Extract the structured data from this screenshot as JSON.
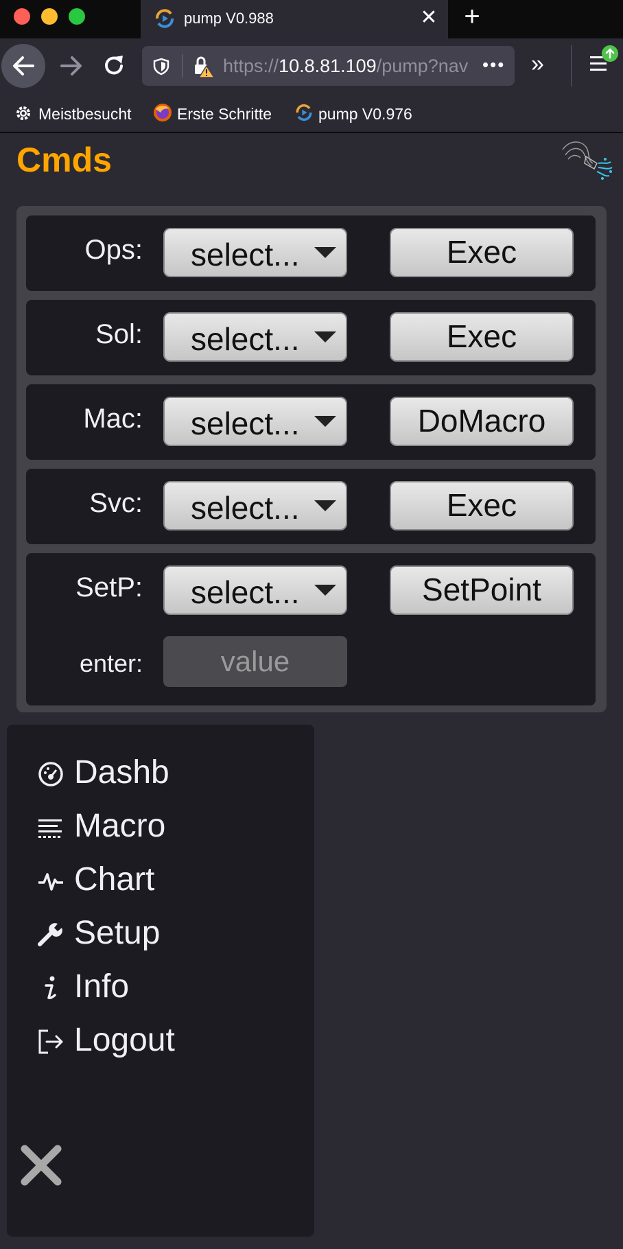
{
  "browser": {
    "tab_title": "pump V0.988",
    "tab_close": "✕",
    "new_tab": "+",
    "url": {
      "scheme": "https://",
      "host": "10.8.81.109",
      "path": "/pump?nav",
      "more": "•••"
    },
    "overflow": "»",
    "bookmarks": [
      "Meistbesucht",
      "Erste Schritte",
      "pump V0.976"
    ]
  },
  "page": {
    "title": "Cmds",
    "accent_color": "#ffa500",
    "rows": [
      {
        "label": "Ops:",
        "select": "select...",
        "button": "Exec"
      },
      {
        "label": "Sol:",
        "select": "select...",
        "button": "Exec"
      },
      {
        "label": "Mac:",
        "select": "select...",
        "button": "DoMacro"
      },
      {
        "label": "Svc:",
        "select": "select...",
        "button": "Exec"
      },
      {
        "label": "SetP:",
        "select": "select...",
        "button": "SetPoint"
      }
    ],
    "enter_label": "enter:",
    "value_placeholder": "value"
  },
  "nav": {
    "items": [
      {
        "label": "Dashb",
        "icon": "dashboard-icon"
      },
      {
        "label": "Macro",
        "icon": "list-icon"
      },
      {
        "label": "Chart",
        "icon": "pulse-icon"
      },
      {
        "label": "Setup",
        "icon": "wrench-icon"
      },
      {
        "label": "Info",
        "icon": "info-icon"
      },
      {
        "label": "Logout",
        "icon": "logout-icon"
      }
    ],
    "close_icon": "close-icon"
  }
}
